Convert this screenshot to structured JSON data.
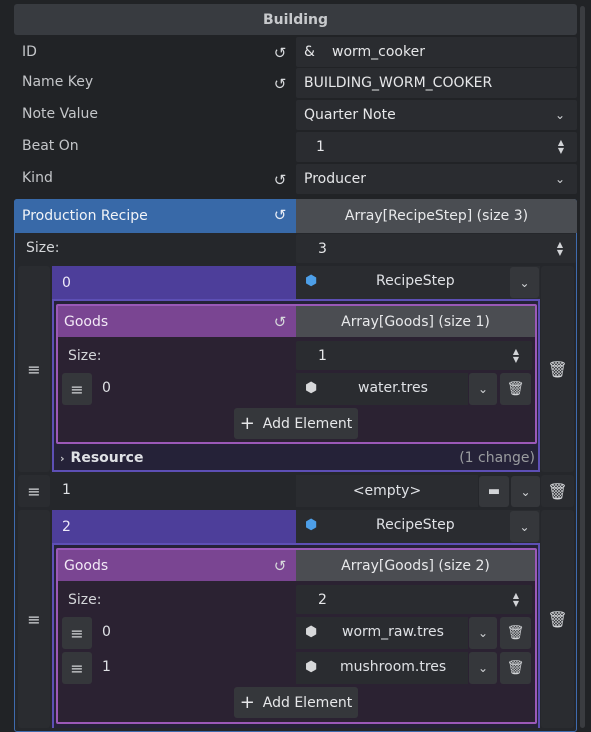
{
  "header": {
    "title": "Building"
  },
  "props": {
    "id": {
      "label": "ID",
      "prefix": "&",
      "value": "worm_cooker"
    },
    "name_key": {
      "label": "Name Key",
      "value": "BUILDING_WORM_COOKER"
    },
    "note_value": {
      "label": "Note Value",
      "value": "Quarter Note"
    },
    "beat_on": {
      "label": "Beat On",
      "value": "1"
    },
    "kind": {
      "label": "Kind",
      "value": "Producer"
    }
  },
  "recipe": {
    "label": "Production Recipe",
    "array_label": "Array[RecipeStep] (size 3)",
    "size_label": "Size:",
    "size_value": "3",
    "items": [
      {
        "index": "0",
        "type": "RecipeStep",
        "goods": {
          "label": "Goods",
          "array_label": "Array[Goods] (size 1)",
          "size_label": "Size:",
          "size_value": "1",
          "elements": [
            {
              "index": "0",
              "value": "water.tres"
            }
          ],
          "add_label": "Add Element"
        },
        "resource": {
          "label": "Resource",
          "changes": "(1 change)"
        }
      },
      {
        "index": "1",
        "value": "<empty>"
      },
      {
        "index": "2",
        "type": "RecipeStep",
        "goods": {
          "label": "Goods",
          "array_label": "Array[Goods] (size 2)",
          "size_label": "Size:",
          "size_value": "2",
          "elements": [
            {
              "index": "0",
              "value": "worm_raw.tres"
            },
            {
              "index": "1",
              "value": "mushroom.tres"
            }
          ],
          "add_label": "Add Element"
        }
      }
    ]
  },
  "icons": {
    "revert": "revert-icon",
    "chevron": "chevron-down-icon",
    "spinner": "up-down-icon",
    "handle": "drag-handle-icon",
    "trash": "trash-icon",
    "folder": "folder-icon",
    "resource": "cube-icon"
  },
  "colors": {
    "recipe_blue": "#3869a8",
    "step_purple": "#4d3e9a",
    "goods_purple": "#7a4592"
  }
}
